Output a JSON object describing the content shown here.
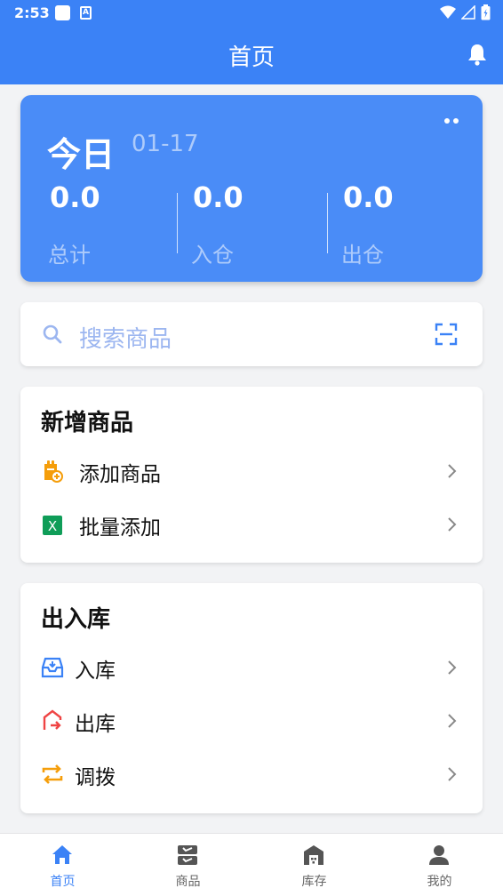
{
  "status_bar": {
    "time": "2:53",
    "badge_letter": "A"
  },
  "header": {
    "title": "首页"
  },
  "summary": {
    "today_label": "今日",
    "date": "01-17",
    "stats": [
      {
        "value": "0.0",
        "label": "总计"
      },
      {
        "value": "0.0",
        "label": "入仓"
      },
      {
        "value": "0.0",
        "label": "出仓"
      }
    ]
  },
  "search": {
    "placeholder": "搜索商品"
  },
  "add_section": {
    "title": "新增商品",
    "items": [
      {
        "label": "添加商品",
        "icon": "add-product-icon"
      },
      {
        "label": "批量添加",
        "icon": "excel-icon",
        "icon_text": "X"
      }
    ]
  },
  "stock_section": {
    "title": "出入库",
    "items": [
      {
        "label": "入库",
        "icon": "inbound-icon"
      },
      {
        "label": "出库",
        "icon": "outbound-icon"
      },
      {
        "label": "调拨",
        "icon": "transfer-icon"
      }
    ]
  },
  "bottom_nav": {
    "items": [
      {
        "label": "首页",
        "active": true
      },
      {
        "label": "商品",
        "active": false
      },
      {
        "label": "库存",
        "active": false
      },
      {
        "label": "我的",
        "active": false
      }
    ]
  },
  "colors": {
    "primary": "#3b82f6",
    "card": "#4a8cf7",
    "orange": "#f59e0b",
    "green": "#0f9d58",
    "red": "#ef4444"
  }
}
